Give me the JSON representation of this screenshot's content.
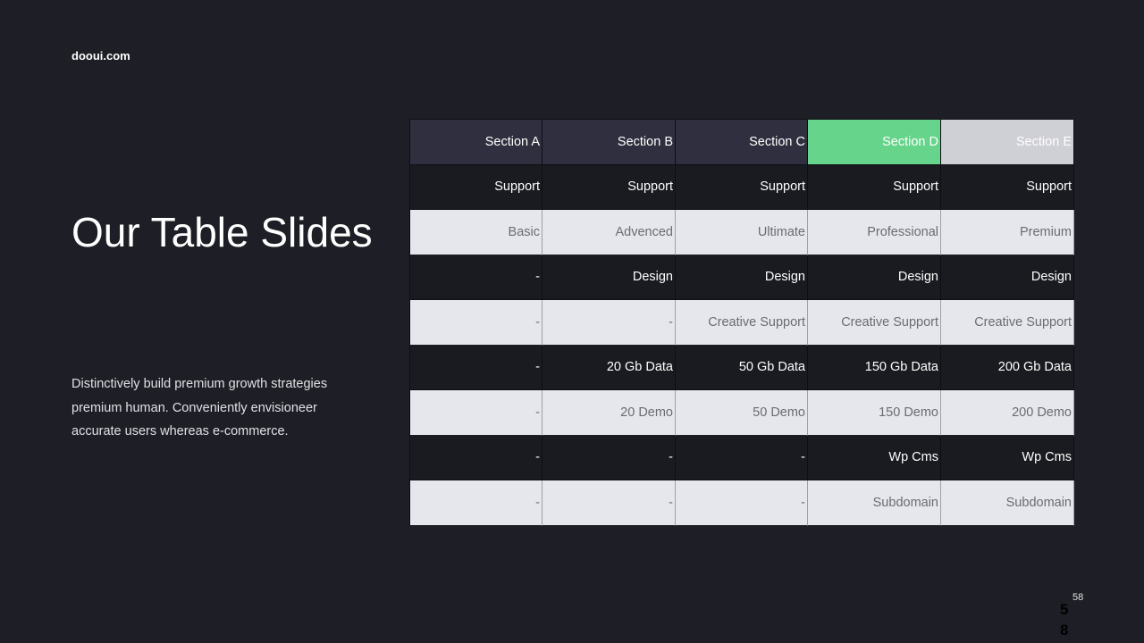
{
  "brand": "dooui.com",
  "title": "Our Table Slides",
  "description": "Distinctively build premium growth strategies premium human. Conveniently envisioneer accurate users whereas e-commerce.",
  "page_number": "58",
  "page_number_small": "58",
  "colors": {
    "background": "#1e1f26",
    "header": "#2f2f3f",
    "accent_green": "#66d48a",
    "header_light": "#cfcfd6",
    "row_light": "#e6e7ec",
    "row_dark": "#1a1b20"
  },
  "table": {
    "headers": [
      "Section A",
      "Section B",
      "Section C",
      "Section D",
      "Section E"
    ],
    "rows": [
      [
        "Support",
        "Support",
        "Support",
        "Support",
        "Support"
      ],
      [
        "Basic",
        "Advenced",
        "Ultimate",
        "Professional",
        "Premium"
      ],
      [
        "-",
        "Design",
        "Design",
        "Design",
        "Design"
      ],
      [
        "-",
        "-",
        "Creative Support",
        "Creative Support",
        "Creative Support"
      ],
      [
        "-",
        "20 Gb Data",
        "50 Gb Data",
        "150 Gb Data",
        "200 Gb Data"
      ],
      [
        "-",
        "20 Demo",
        "50 Demo",
        "150 Demo",
        "200 Demo"
      ],
      [
        "-",
        "-",
        "-",
        "Wp Cms",
        "Wp Cms"
      ],
      [
        "-",
        "-",
        "-",
        "Subdomain",
        "Subdomain"
      ]
    ]
  }
}
